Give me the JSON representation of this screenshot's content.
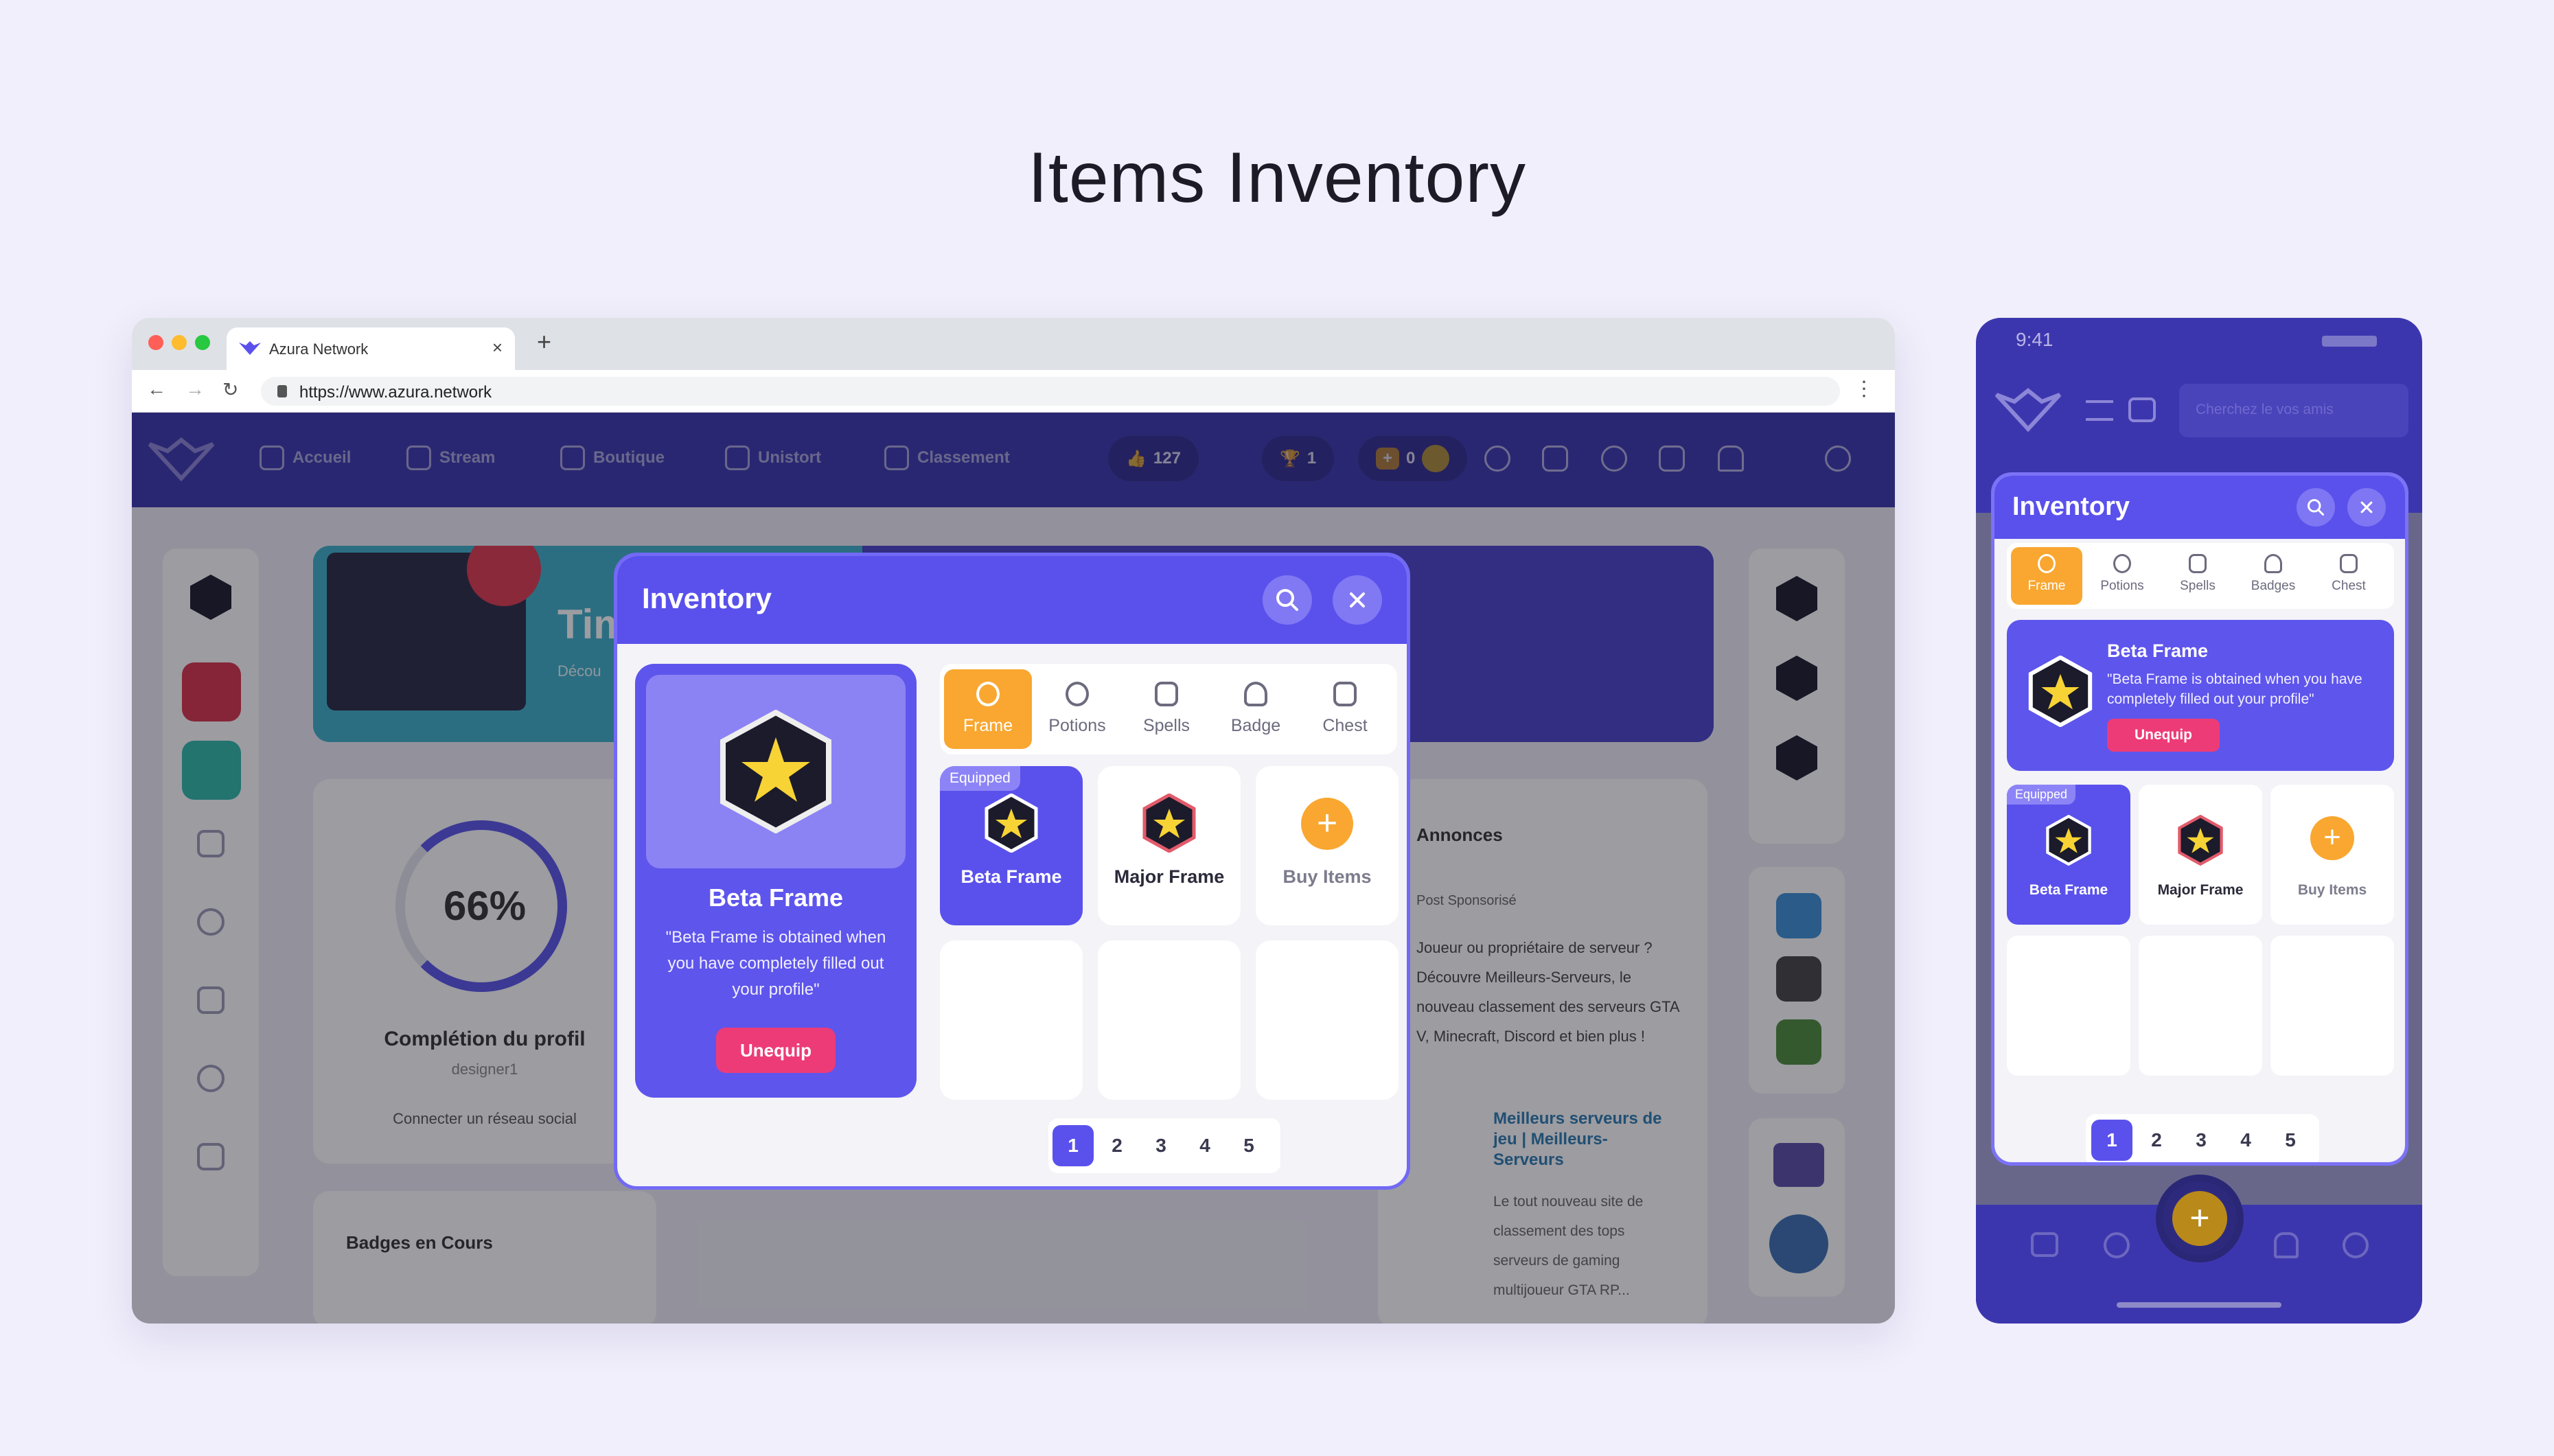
{
  "page_title": "Items Inventory",
  "browser": {
    "tab_title": "Azura Network",
    "url": "https://www.azura.network",
    "new_tab": "+",
    "close_tab": "×"
  },
  "app": {
    "nav": [
      "Accueil",
      "Stream",
      "Boutique",
      "Unistort",
      "Classement"
    ],
    "stats": {
      "likes": "127",
      "trophies": "1",
      "coins": "0"
    },
    "banner_text": "Tim",
    "banner_sub": "Décou",
    "profile": {
      "percent": "66%",
      "label": "Complétion du profil",
      "user": "designer1",
      "link": "Connecter un réseau social"
    },
    "badges_title": "Badges en Cours",
    "annonces": {
      "title": "Annonces",
      "sponsored": "Post Sponsorisé",
      "text": "Joueur ou propriétaire de serveur ? Découvre Meilleurs-Serveurs, le nouveau classement des serveurs GTA V, Minecraft, Discord et bien plus !",
      "post_title": "Meilleurs serveurs de jeu | Meilleurs-Serveurs",
      "post_text": "Le tout nouveau site de classement des tops serveurs de gaming multijoueur GTA RP..."
    }
  },
  "modal": {
    "title": "Inventory",
    "tabs": [
      "Frame",
      "Potions",
      "Spells",
      "Badge",
      "Chest"
    ],
    "preview": {
      "name": "Beta Frame",
      "description": "\"Beta Frame is obtained when you have completely filled out your profile\"",
      "button": "Unequip"
    },
    "items": [
      {
        "name": "Beta Frame",
        "tag": "Equipped"
      },
      {
        "name": "Major Frame"
      },
      {
        "name": "Buy Items"
      }
    ],
    "pages": [
      "1",
      "2",
      "3",
      "4",
      "5"
    ],
    "active_page": "1"
  },
  "phone": {
    "time": "9:41",
    "search_placeholder": "Cherchez le vos amis",
    "modal": {
      "title": "Inventory",
      "tabs": [
        "Frame",
        "Potions",
        "Spells",
        "Badges",
        "Chest"
      ],
      "preview": {
        "name": "Beta Frame",
        "description": "\"Beta Frame is obtained when you have completely filled out your profile\"",
        "button": "Unequip"
      },
      "items": [
        {
          "name": "Beta Frame",
          "tag": "Equipped"
        },
        {
          "name": "Major Frame"
        },
        {
          "name": "Buy Items"
        }
      ],
      "pages": [
        "1",
        "2",
        "3",
        "4",
        "5"
      ]
    },
    "fab": "+"
  },
  "colors": {
    "primary": "#5a51ec",
    "nav": "#3c36ae",
    "accent": "#f9a731",
    "danger": "#ed3b78",
    "page_bg": "#f1effb"
  }
}
